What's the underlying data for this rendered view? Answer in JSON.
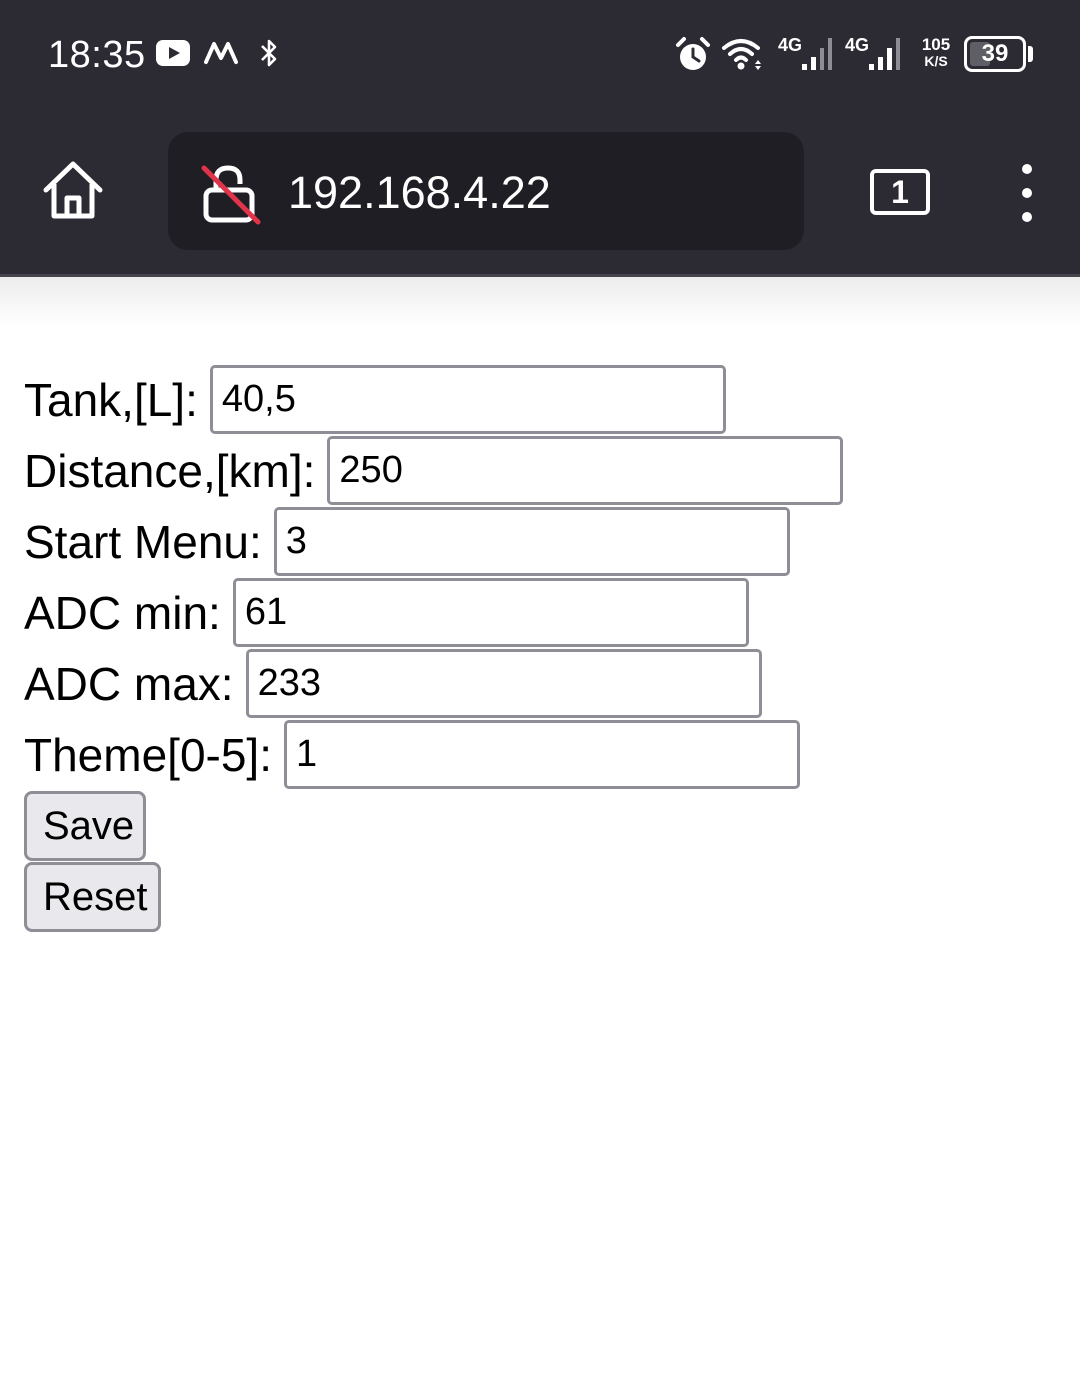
{
  "status_bar": {
    "time": "18:35",
    "network1": "4G",
    "network2": "4G",
    "speed_value": "105",
    "speed_unit": "K/S",
    "battery_level": "39",
    "battery_fraction": 0.39,
    "icons": [
      "youtube-icon",
      "m-icon",
      "bluetooth-icon",
      "alarm-icon",
      "wifi-icon",
      "signal-icon",
      "signal-icon"
    ]
  },
  "browser": {
    "url": "192.168.4.22",
    "tab_count": "1",
    "icons": [
      "home-icon",
      "insecure-lock-icon",
      "tabs-icon",
      "menu-icon"
    ]
  },
  "form": {
    "fields": [
      {
        "label": "Tank,[L]:",
        "value": "40,5"
      },
      {
        "label": "Distance,[km]:",
        "value": "250"
      },
      {
        "label": "Start Menu:",
        "value": "3"
      },
      {
        "label": "ADC min:",
        "value": "61"
      },
      {
        "label": "ADC max:",
        "value": "233"
      },
      {
        "label": "Theme[0-5]:",
        "value": "1"
      }
    ],
    "save_label": "Save",
    "reset_label": "Reset"
  },
  "colors": {
    "chrome_bg": "#2c2b34",
    "urlbar_bg": "#1f1e24",
    "input_border": "#8f8d96",
    "button_bg": "#e9e9ed",
    "insecure_strike": "#e0344a"
  }
}
